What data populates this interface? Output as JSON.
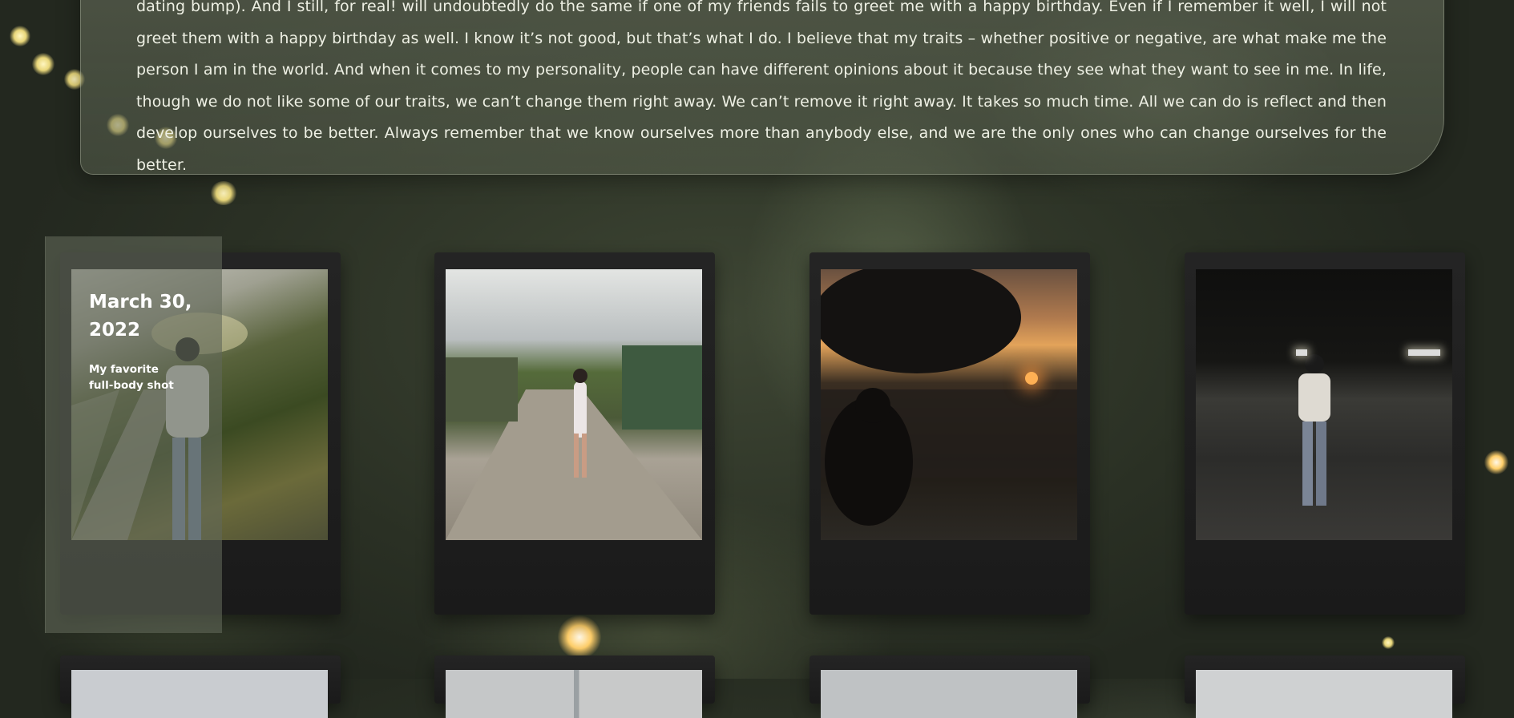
{
  "about": {
    "paragraph": "dating bump). And I still, for real! will undoubtedly do the same if one of my friends fails to greet me with a happy birthday. Even if I remember it well, I will not greet them with a happy birthday as well. I know it’s not good, but that’s what I do. I believe that my traits – whether positive or negative, are what make me the person I am in the world. And when it comes to my personality, people can have different opinions about it because they see what they want to see in me. In life, though we do not like some of our traits, we can’t change them right away. We can’t remove it right away. It takes so much time. All we can do is reflect and then develop ourselves to be better. Always remember that we know ourselves more than anybody else, and we are the only ones who can change ourselves for the better."
  },
  "gallery": {
    "items": [
      {
        "date": "March 30, 2022",
        "caption": "My favorite full-body shot",
        "photo": "woman-with-umbrella-on-roadside"
      },
      {
        "photo": "woman-in-dress-on-street"
      },
      {
        "photo": "silhouette-at-sunset"
      },
      {
        "photo": "woman-standing-at-night"
      }
    ]
  },
  "colors": {
    "background": "#2a3024",
    "panel": "#5c6452",
    "frame": "#1e1e1e",
    "text": "#eef0e4"
  }
}
